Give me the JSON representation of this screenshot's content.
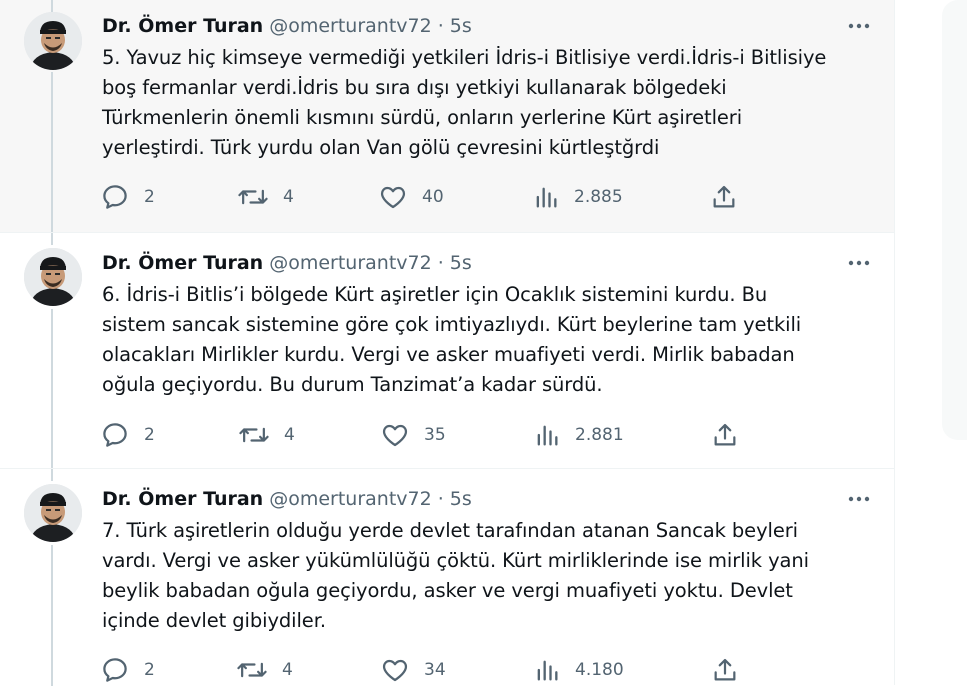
{
  "tweets": [
    {
      "author_name": "Dr. Ömer Turan",
      "handle": "@omerturantv72",
      "separator": "·",
      "time": "5s",
      "text": "5. Yavuz hiç kimseye vermediği yetkileri İdris-i Bitlisiye verdi.İdris-i Bitlisiye\nboş fermanlar verdi.İdris bu sıra dışı yetkiyi kullanarak bölgedeki\nTürkmenlerin önemli kısmını sürdü, onların yerlerine Kürt aşiretleri\nyerleştirdi. Türk yurdu olan Van gölü çevresini kürtleştğrdi",
      "replies": "2",
      "retweets": "4",
      "likes": "40",
      "views": "2.885"
    },
    {
      "author_name": "Dr. Ömer Turan",
      "handle": "@omerturantv72",
      "separator": "·",
      "time": "5s",
      "text": "6. İdris-i Bitlis’i bölgede Kürt aşiretler için Ocaklık sistemini kurdu. Bu\nsistem sancak sistemine göre çok imtiyazlıydı. Kürt beylerine tam yetkili\nolacakları Mirlikler kurdu. Vergi ve asker muafiyeti verdi. Mirlik babadan\noğula geçiyordu. Bu durum Tanzimat’a kadar sürdü.",
      "replies": "2",
      "retweets": "4",
      "likes": "35",
      "views": "2.881"
    },
    {
      "author_name": "Dr. Ömer Turan",
      "handle": "@omerturantv72",
      "separator": "·",
      "time": "5s",
      "text": "7. Türk aşiretlerin olduğu yerde devlet tarafından atanan Sancak beyleri\nvardı. Vergi ve asker yükümlülüğü çöktü. Kürt mirliklerinde ise mirlik yani\nbeylik babadan oğula geçiyordu, asker ve vergi muafiyeti yoktu. Devlet\niçinde devlet gibiydiler.",
      "replies": "2",
      "retweets": "4",
      "likes": "34",
      "views": "4.180"
    }
  ],
  "colors": {
    "text": "#0f1419",
    "secondary": "#536471",
    "thread_line": "#cfd9de",
    "highlight_bg": "#f7f7f7"
  },
  "icons": [
    "more-icon",
    "reply-icon",
    "retweet-icon",
    "like-icon",
    "views-icon",
    "share-icon"
  ]
}
